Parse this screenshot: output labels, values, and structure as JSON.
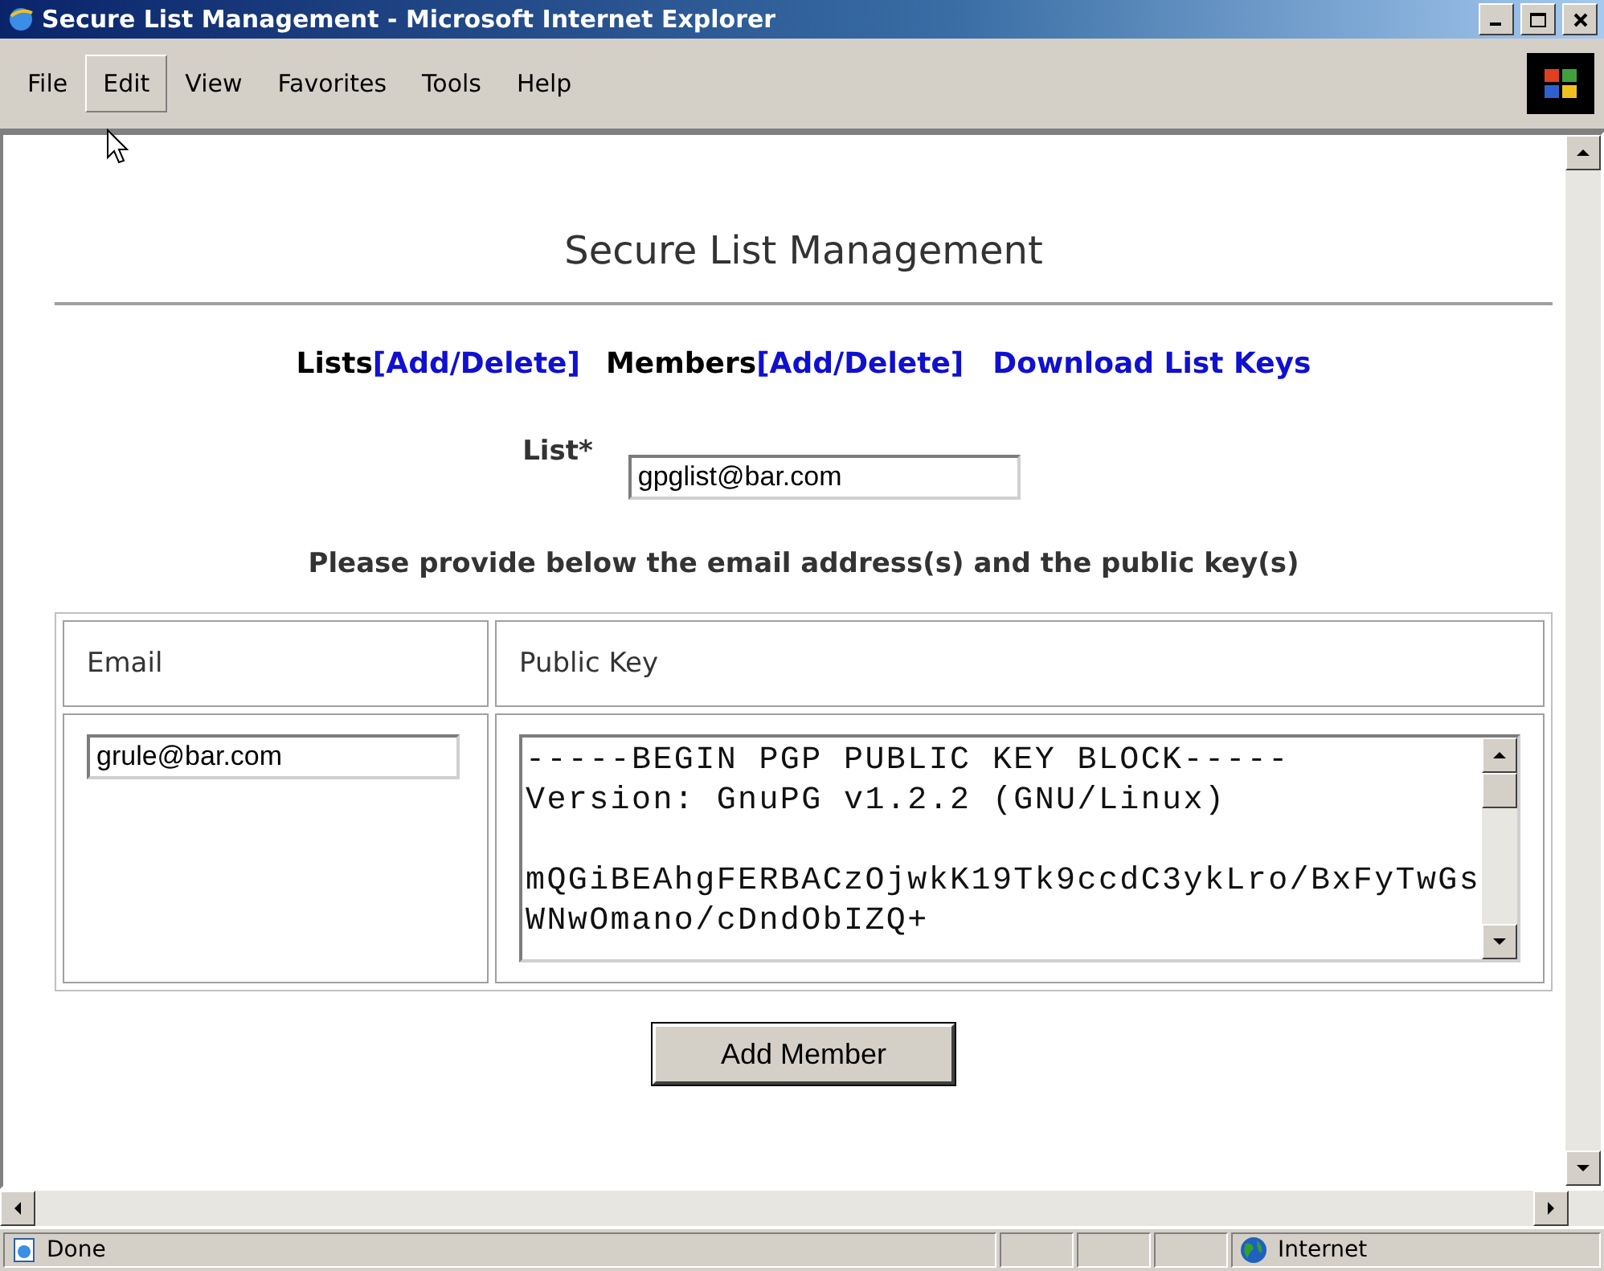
{
  "window": {
    "title": "Secure List Management - Microsoft Internet Explorer"
  },
  "menu": [
    {
      "label": "File",
      "highlighted": false
    },
    {
      "label": "Edit",
      "highlighted": true
    },
    {
      "label": "View",
      "highlighted": false
    },
    {
      "label": "Favorites",
      "highlighted": false
    },
    {
      "label": "Tools",
      "highlighted": false
    },
    {
      "label": "Help",
      "highlighted": false
    }
  ],
  "page": {
    "heading": "Secure List Management",
    "nav": [
      {
        "kind": "label",
        "text": "Lists"
      },
      {
        "kind": "punct",
        "text": "["
      },
      {
        "kind": "link",
        "text": "Add"
      },
      {
        "kind": "punct",
        "text": "/"
      },
      {
        "kind": "link",
        "text": "Delete"
      },
      {
        "kind": "punct",
        "text": "]"
      },
      {
        "kind": "label",
        "text": "Members"
      },
      {
        "kind": "punct",
        "text": "["
      },
      {
        "kind": "link",
        "text": "Add"
      },
      {
        "kind": "punct",
        "text": "/"
      },
      {
        "kind": "link",
        "text": "Delete"
      },
      {
        "kind": "punct",
        "text": "]"
      },
      {
        "kind": "link",
        "text": "Download List Keys"
      }
    ],
    "list_field": {
      "label": "List*",
      "value": "gpglist@bar.com"
    },
    "instruction": "Please provide below the email address(s) and the public key(s)",
    "table": {
      "columns": [
        "Email",
        "Public Key"
      ],
      "email_value": "grule@bar.com",
      "key_value": "-----BEGIN PGP PUBLIC KEY BLOCK-----\nVersion: GnuPG v1.2.2 (GNU/Linux)\n\nmQGiBEAhgFERBACzOjwkK19Tk9ccdC3ykLro/BxFyTwGs\nWNwOmano/cDndObIZQ+"
    },
    "submit": "Add Member"
  },
  "status_bar": {
    "text": "Done",
    "zone": "Internet"
  }
}
